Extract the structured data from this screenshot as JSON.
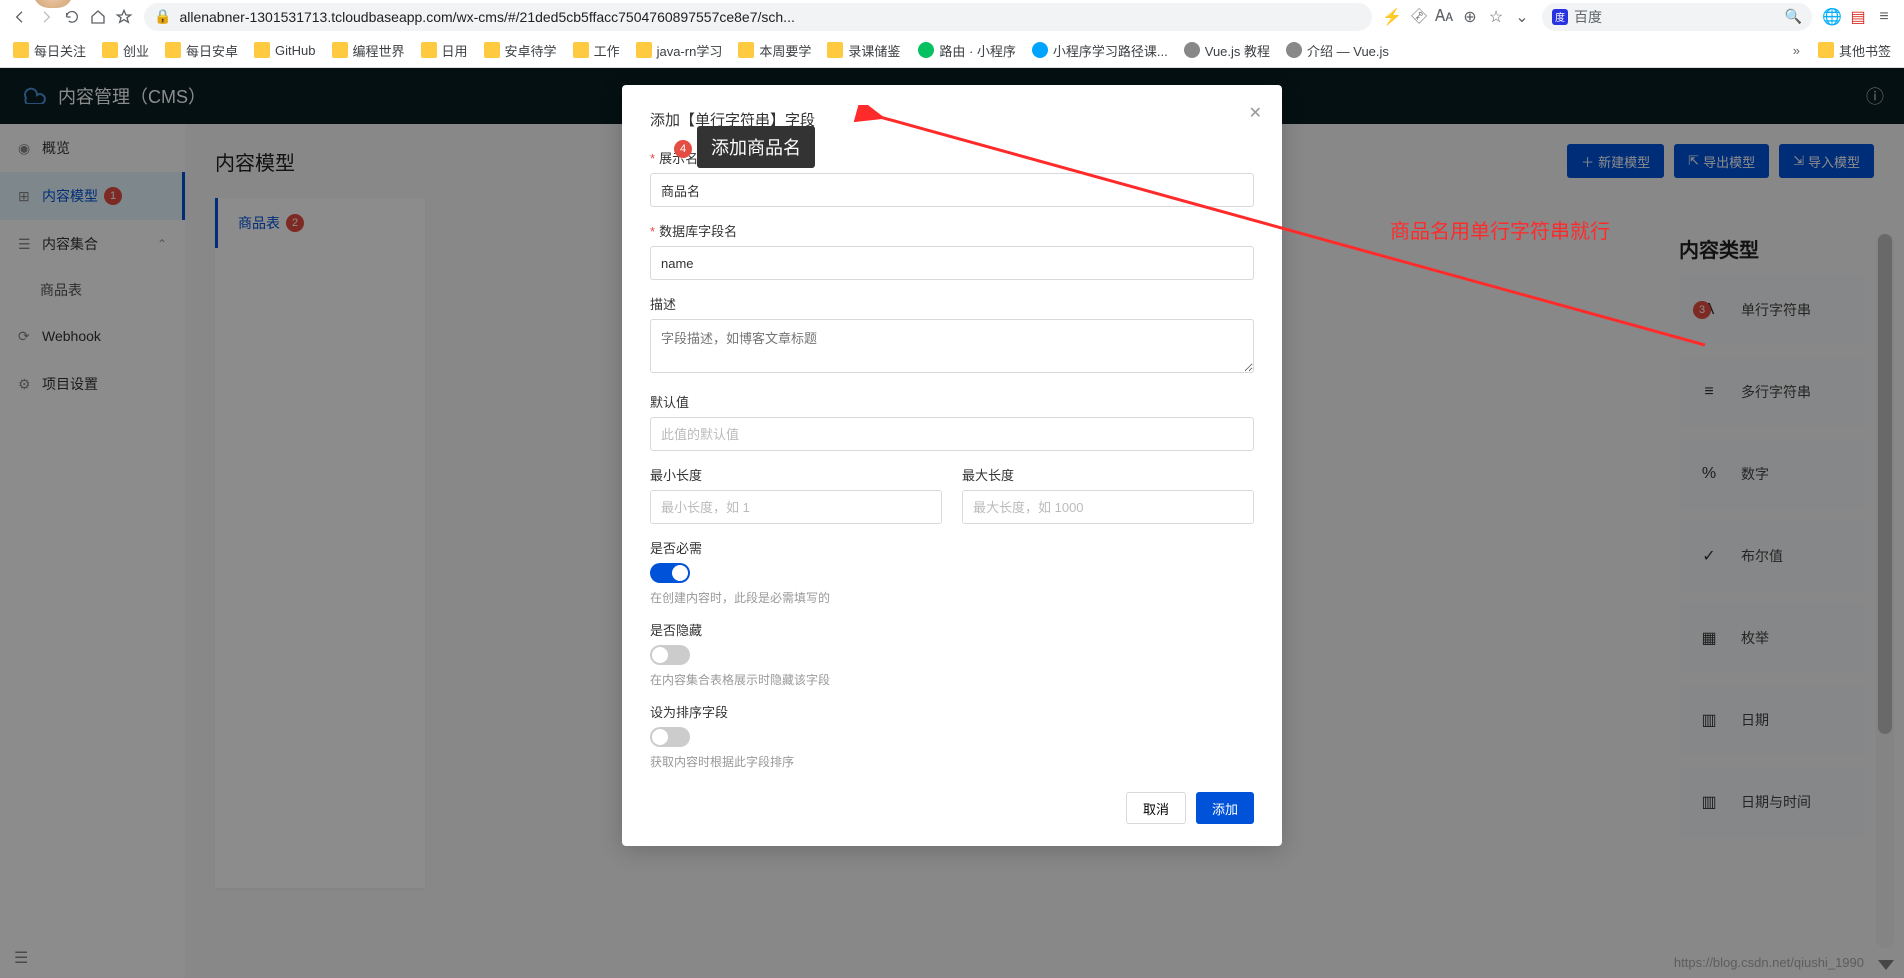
{
  "browser": {
    "url_display": "allenabner-1301531713.tcloudbaseapp.com/wx-cms/#/21ded5cb5ffacc7504760897557ce8e7/sch...",
    "search_engine_label": "百度",
    "bookmarks": [
      "每日关注",
      "创业",
      "每日安卓",
      "GitHub",
      "编程世界",
      "日用",
      "安卓待学",
      "工作",
      "java-rn学习",
      "本周要学",
      "录课储鉴"
    ],
    "link_bookmarks": [
      {
        "label": "路由 · 小程序",
        "color": "#07c160"
      },
      {
        "label": "小程序学习路径课...",
        "color": "#00a4ff"
      },
      {
        "label": "Vue.js 教程",
        "color": "#888"
      },
      {
        "label": "介绍 — Vue.js",
        "color": "#888"
      }
    ],
    "other_label": "其他书签"
  },
  "app": {
    "title": "内容管理（CMS）",
    "sidebar": [
      {
        "icon": "eye",
        "label": "概览"
      },
      {
        "icon": "model",
        "label": "内容模型",
        "active": true,
        "badge": "1"
      },
      {
        "icon": "list",
        "label": "内容集合",
        "expandable": true
      },
      {
        "sub": true,
        "label": "商品表"
      },
      {
        "icon": "webhook",
        "label": "Webhook"
      },
      {
        "icon": "gear",
        "label": "项目设置"
      }
    ],
    "page_title": "内容模型",
    "buttons": {
      "new": "新建模型",
      "export": "导出模型",
      "import": "导入模型"
    },
    "tab_item": "商品表",
    "tab_badge": "2",
    "content_types_title": "内容类型",
    "content_types": [
      {
        "icon": "A",
        "label": "单行字符串",
        "badge": "3"
      },
      {
        "icon": "≡",
        "label": "多行字符串"
      },
      {
        "icon": "%",
        "label": "数字"
      },
      {
        "icon": "✓",
        "label": "布尔值"
      },
      {
        "icon": "▦",
        "label": "枚举"
      },
      {
        "icon": "▥",
        "label": "日期"
      },
      {
        "icon": "▥",
        "label": "日期与时间"
      }
    ]
  },
  "modal": {
    "title": "添加【单行字符串】字段",
    "tooltip": "添加商品名",
    "tooltip_badge": "4",
    "labels": {
      "display": "展示名称",
      "db": "数据库字段名",
      "desc": "描述",
      "default": "默认值",
      "min": "最小长度",
      "max": "最大长度",
      "required": "是否必需",
      "hidden": "是否隐藏",
      "sort": "设为排序字段"
    },
    "values": {
      "display": "商品名",
      "db": "name"
    },
    "placeholders": {
      "desc": "字段描述，如博客文章标题",
      "default": "此值的默认值",
      "min": "最小长度，如 1",
      "max": "最大长度，如 1000"
    },
    "helps": {
      "required": "在创建内容时，此段是必需填写的",
      "hidden": "在内容集合表格展示时隐藏该字段",
      "sort": "获取内容时根据此字段排序"
    },
    "footer": {
      "cancel": "取消",
      "ok": "添加"
    }
  },
  "annotations": {
    "red_note": "商品名用单行字符串就行"
  },
  "watermark": "https://blog.csdn.net/qiushi_1990"
}
